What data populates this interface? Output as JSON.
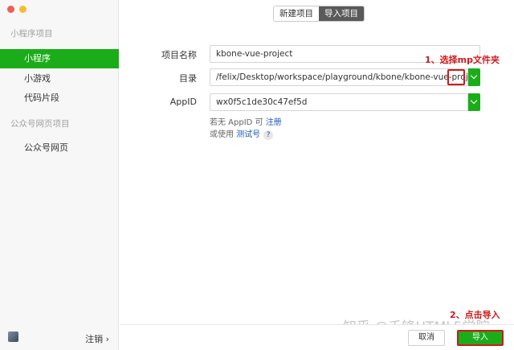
{
  "sidebar": {
    "section_mini": "小程序项目",
    "items": [
      {
        "label": "小程序"
      },
      {
        "label": "小游戏"
      },
      {
        "label": "代码片段"
      }
    ],
    "section_web": "公众号网页项目",
    "web_item": "公众号网页",
    "logout": "注销 ›"
  },
  "tabs": [
    {
      "label": "新建项目"
    },
    {
      "label": "导入项目"
    }
  ],
  "form": {
    "project_name_label": "项目名称",
    "project_name_value": "kbone-vue-project",
    "dir_label": "目录",
    "dir_value": "/felix/Desktop/workspace/playground/kbone/kbone-vue-project/dist/",
    "dir_highlight": "mp",
    "appid_label": "AppID",
    "appid_value": "wx0f5c1de30c47ef5d",
    "hint1_prefix": "若无 AppID 可 ",
    "hint1_link": "注册",
    "hint2_prefix": "或使用 ",
    "hint2_link": "测试号",
    "hint2_q": "?"
  },
  "annotations": {
    "step1": "1、选择mp文件夹",
    "step2": "2、点击导入"
  },
  "buttons": {
    "cancel": "取消",
    "import": "导入"
  },
  "watermark": "知乎 @千锋HTML5学院",
  "colors": {
    "accent_green": "#1aad19",
    "annotation_red": "#d0191c"
  }
}
